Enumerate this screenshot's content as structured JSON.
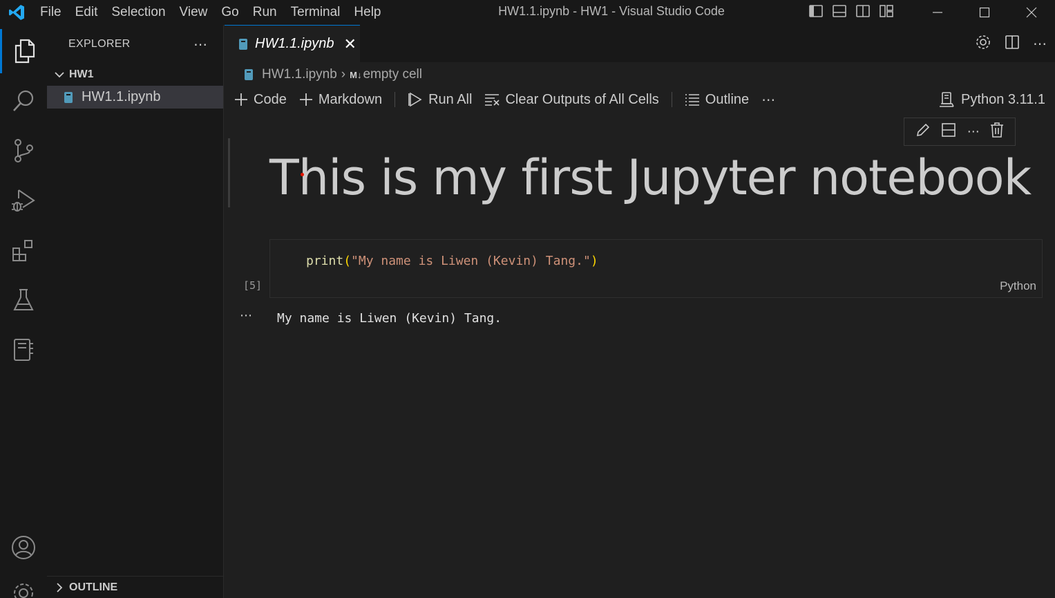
{
  "window": {
    "title": "HW1.1.ipynb - HW1 - Visual Studio Code"
  },
  "menu": [
    "File",
    "Edit",
    "Selection",
    "View",
    "Go",
    "Run",
    "Terminal",
    "Help"
  ],
  "sidebar": {
    "title": "EXPLORER",
    "folder": "HW1",
    "files": [
      "HW1.1.ipynb"
    ],
    "outline_title": "OUTLINE"
  },
  "tab": {
    "label": "HW1.1.ipynb"
  },
  "breadcrumb": {
    "file": "HW1.1.ipynb",
    "md_badge": "M↓",
    "cell": "empty cell"
  },
  "toolbar": {
    "code": "Code",
    "markdown": "Markdown",
    "run_all": "Run All",
    "clear_outputs": "Clear Outputs of All Cells",
    "outline": "Outline",
    "kernel": "Python 3.11.1"
  },
  "notebook": {
    "markdown_heading": "This is my first Jupyter notebook",
    "code_cell": {
      "fn": "print",
      "open": "(",
      "string": "\"My name is Liwen (Kevin) Tang.\"",
      "close": ")",
      "language": "Python",
      "execution_count": "[5]"
    },
    "output": "My name is Liwen (Kevin) Tang."
  },
  "colors": {
    "accent": "#0078d4",
    "vscode_logo": "#23a9f2"
  }
}
